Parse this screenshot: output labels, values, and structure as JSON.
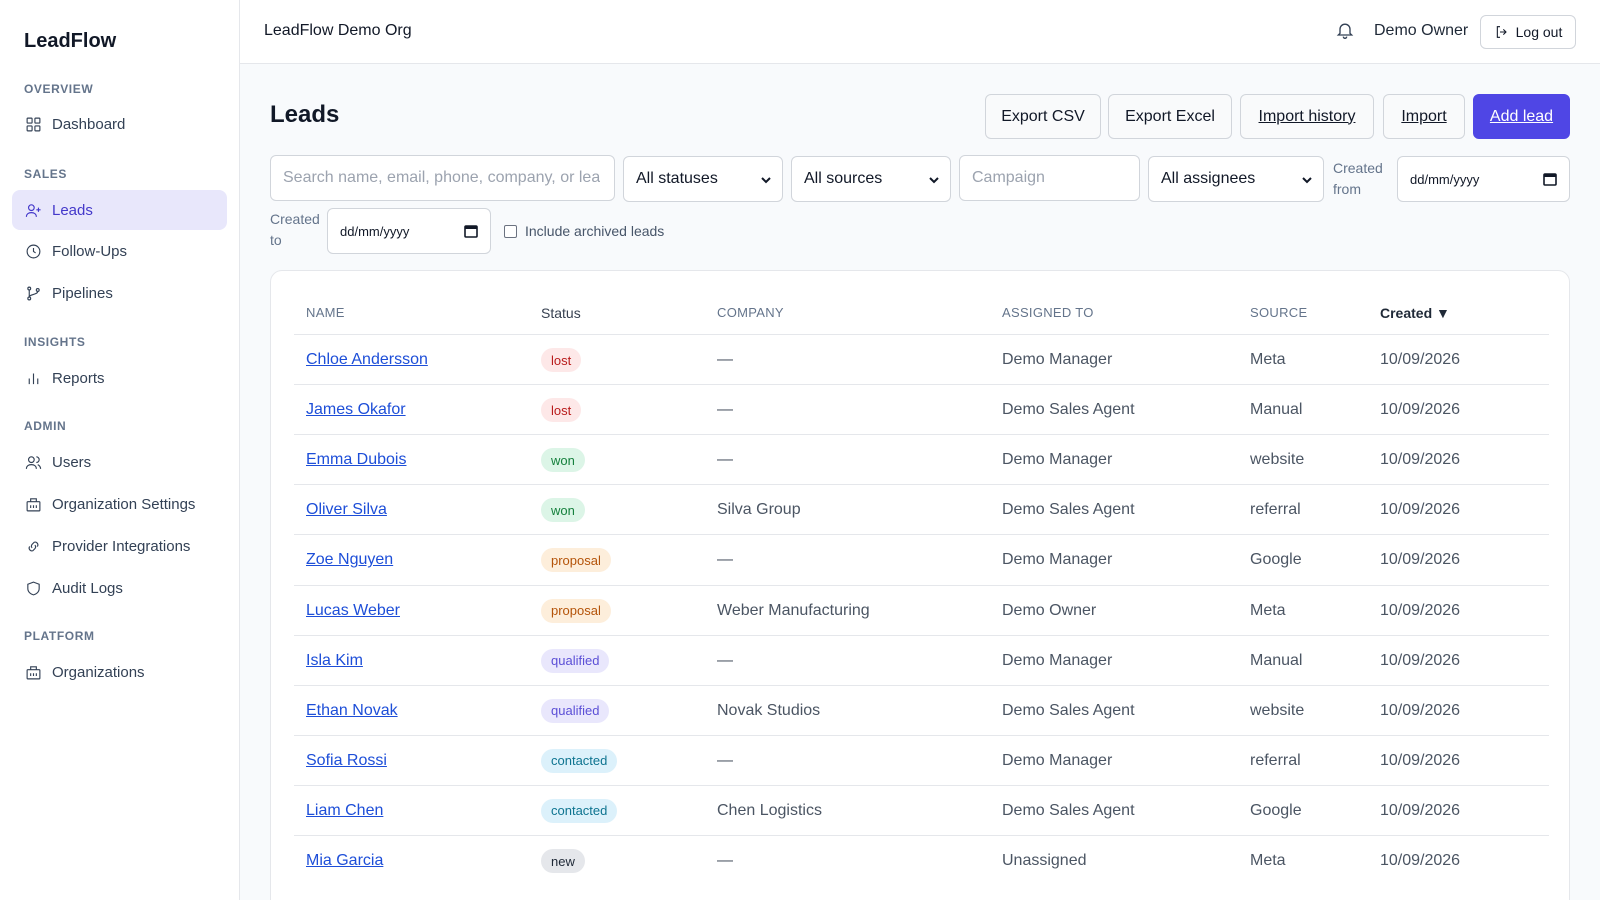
{
  "app": {
    "name": "LeadFlow"
  },
  "sidebar": {
    "sections": [
      {
        "title": "OVERVIEW",
        "items": [
          {
            "label": "Dashboard",
            "icon": "grid-icon"
          }
        ]
      },
      {
        "title": "SALES",
        "items": [
          {
            "label": "Leads",
            "icon": "user-plus-icon",
            "active": true
          },
          {
            "label": "Follow-Ups",
            "icon": "clock-icon"
          },
          {
            "label": "Pipelines",
            "icon": "git-branch-icon"
          }
        ]
      },
      {
        "title": "INSIGHTS",
        "items": [
          {
            "label": "Reports",
            "icon": "bar-chart-icon"
          }
        ]
      },
      {
        "title": "ADMIN",
        "items": [
          {
            "label": "Users",
            "icon": "users-icon"
          },
          {
            "label": "Organization Settings",
            "icon": "building-icon"
          },
          {
            "label": "Provider Integrations",
            "icon": "link-icon"
          },
          {
            "label": "Audit Logs",
            "icon": "shield-icon"
          }
        ]
      },
      {
        "title": "PLATFORM",
        "items": [
          {
            "label": "Organizations",
            "icon": "building-icon"
          }
        ]
      }
    ]
  },
  "topbar": {
    "org_name": "LeadFlow Demo Org",
    "user_name": "Demo Owner",
    "logout_label": "Log out"
  },
  "page": {
    "title": "Leads",
    "actions": {
      "export_csv": "Export CSV",
      "export_excel": "Export Excel",
      "import_history": "Import history",
      "import": "Import",
      "add_lead": "Add lead"
    }
  },
  "filters": {
    "search_placeholder": "Search name, email, phone, company, or lea",
    "status_value": "All statuses",
    "source_value": "All sources",
    "campaign_placeholder": "Campaign",
    "assignee_value": "All assignees",
    "created_from_label_1": "Created",
    "created_from_label_2": "from",
    "created_from_value": "dd/mm/yyyy",
    "created_to_label_1": "Created",
    "created_to_label_2": "to",
    "created_to_value": "dd/mm/yyyy",
    "include_archived_label": "Include archived leads",
    "include_archived_checked": false
  },
  "table": {
    "headers": {
      "name": "NAME",
      "status": "Status",
      "company": "COMPANY",
      "assigned_to": "ASSIGNED TO",
      "source": "SOURCE",
      "created": "Created ▼"
    },
    "rows": [
      {
        "name": "Chloe Andersson",
        "status": "lost",
        "company": "—",
        "assigned_to": "Demo Manager",
        "source": "Meta",
        "created": "10/09/2026"
      },
      {
        "name": "James Okafor",
        "status": "lost",
        "company": "—",
        "assigned_to": "Demo Sales Agent",
        "source": "Manual",
        "created": "10/09/2026"
      },
      {
        "name": "Emma Dubois",
        "status": "won",
        "company": "—",
        "assigned_to": "Demo Manager",
        "source": "website",
        "created": "10/09/2026"
      },
      {
        "name": "Oliver Silva",
        "status": "won",
        "company": "Silva Group",
        "assigned_to": "Demo Sales Agent",
        "source": "referral",
        "created": "10/09/2026"
      },
      {
        "name": "Zoe Nguyen",
        "status": "proposal",
        "company": "—",
        "assigned_to": "Demo Manager",
        "source": "Google",
        "created": "10/09/2026"
      },
      {
        "name": "Lucas Weber",
        "status": "proposal",
        "company": "Weber Manufacturing",
        "assigned_to": "Demo Owner",
        "source": "Meta",
        "created": "10/09/2026"
      },
      {
        "name": "Isla Kim",
        "status": "qualified",
        "company": "—",
        "assigned_to": "Demo Manager",
        "source": "Manual",
        "created": "10/09/2026"
      },
      {
        "name": "Ethan Novak",
        "status": "qualified",
        "company": "Novak Studios",
        "assigned_to": "Demo Sales Agent",
        "source": "website",
        "created": "10/09/2026"
      },
      {
        "name": "Sofia Rossi",
        "status": "contacted",
        "company": "—",
        "assigned_to": "Demo Manager",
        "source": "referral",
        "created": "10/09/2026"
      },
      {
        "name": "Liam Chen",
        "status": "contacted",
        "company": "Chen Logistics",
        "assigned_to": "Demo Sales Agent",
        "source": "Google",
        "created": "10/09/2026"
      },
      {
        "name": "Mia Garcia",
        "status": "new",
        "company": "—",
        "assigned_to": "Unassigned",
        "source": "Meta",
        "created": "10/09/2026"
      }
    ]
  },
  "status_colors": {
    "lost": {
      "bg": "#fde8e8",
      "fg": "#b91c1c"
    },
    "won": {
      "bg": "#dcf5e7",
      "fg": "#15803d"
    },
    "proposal": {
      "bg": "#fdeedb",
      "fg": "#b45309"
    },
    "qualified": {
      "bg": "#e9e7fc",
      "fg": "#5b4fd6"
    },
    "contacted": {
      "bg": "#dcf1fb",
      "fg": "#0e7490"
    },
    "new": {
      "bg": "#e5e7eb",
      "fg": "#1f2937"
    }
  },
  "colors": {
    "accent": "#4f46e5",
    "link": "#1d4ed8"
  }
}
